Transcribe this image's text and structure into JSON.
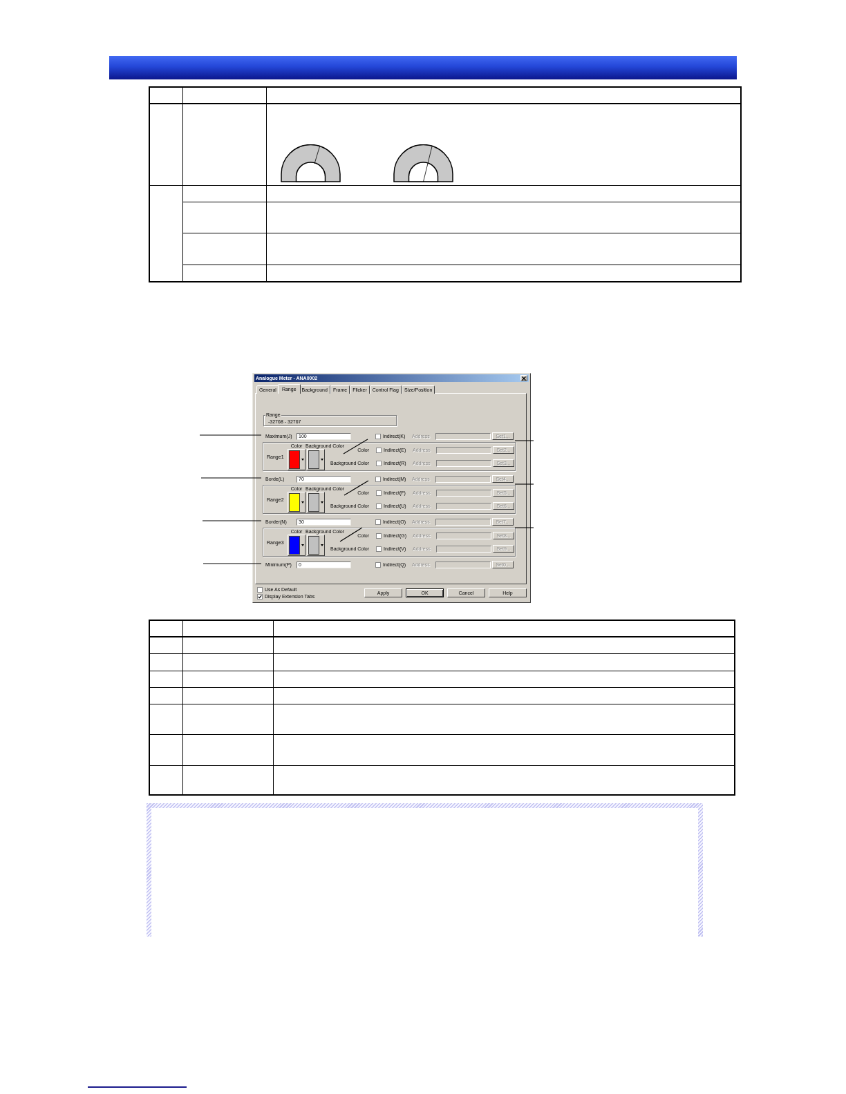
{
  "dialog": {
    "title": "Analogue Meter - ANA0002",
    "tabs": [
      {
        "label": "General",
        "selected": false
      },
      {
        "label": "Range",
        "selected": true
      },
      {
        "label": "Background",
        "selected": false
      },
      {
        "label": "Frame",
        "selected": false
      },
      {
        "label": "Flicker",
        "selected": false
      },
      {
        "label": "Control Flag",
        "selected": false
      },
      {
        "label": "Size/Position",
        "selected": false
      }
    ],
    "range_box": {
      "legend": "Range",
      "value": "-32768 - 32767"
    },
    "rows": [
      {
        "kind": "limit",
        "label": "Maximum(J)",
        "value": "100",
        "indirect": {
          "label": "Indirect(K)",
          "checked": false
        },
        "address": {
          "label": "Address",
          "disabled": true
        },
        "set_button": {
          "label": "Set1...",
          "disabled": true
        }
      },
      {
        "kind": "range",
        "label": "Range1",
        "color_header": "Color",
        "background_header": "Background Color",
        "color": "#ff0000",
        "targets": [
          {
            "label": "Color",
            "indirect": {
              "label": "Indirect(E)",
              "checked": false
            },
            "address": {
              "label": "Address",
              "disabled": true
            },
            "set_button": {
              "label": "Set2...",
              "disabled": true
            }
          },
          {
            "label": "Background Color",
            "indirect": {
              "label": "Indirect(R)",
              "checked": false
            },
            "address": {
              "label": "Address",
              "disabled": true
            },
            "set_button": {
              "label": "Set3...",
              "disabled": true
            }
          }
        ]
      },
      {
        "kind": "limit",
        "label": "Borde(L)",
        "value": "70",
        "indirect": {
          "label": "Indirect(M)",
          "checked": false
        },
        "address": {
          "label": "Address",
          "disabled": true
        },
        "set_button": {
          "label": "Set4...",
          "disabled": true
        }
      },
      {
        "kind": "range",
        "label": "Range2",
        "color_header": "Color",
        "background_header": "Background Color",
        "color": "#ffff00",
        "targets": [
          {
            "label": "Color",
            "indirect": {
              "label": "Indirect(F)",
              "checked": false
            },
            "address": {
              "label": "Address",
              "disabled": true
            },
            "set_button": {
              "label": "Set5...",
              "disabled": true
            }
          },
          {
            "label": "Background Color",
            "indirect": {
              "label": "Indirect(U)",
              "checked": false
            },
            "address": {
              "label": "Address",
              "disabled": true
            },
            "set_button": {
              "label": "Set6...",
              "disabled": true
            }
          }
        ]
      },
      {
        "kind": "limit",
        "label": "Border(N)",
        "value": "30",
        "indirect": {
          "label": "Indirect(O)",
          "checked": false
        },
        "address": {
          "label": "Address",
          "disabled": true
        },
        "set_button": {
          "label": "Set7...",
          "disabled": true
        }
      },
      {
        "kind": "range",
        "label": "Range3",
        "color_header": "Color",
        "background_header": "Background Color",
        "color": "#0000ff",
        "targets": [
          {
            "label": "Color",
            "indirect": {
              "label": "Indirect(G)",
              "checked": false
            },
            "address": {
              "label": "Address",
              "disabled": true
            },
            "set_button": {
              "label": "Set8...",
              "disabled": true
            }
          },
          {
            "label": "Background Color",
            "indirect": {
              "label": "Indirect(V)",
              "checked": false
            },
            "address": {
              "label": "Address",
              "disabled": true
            },
            "set_button": {
              "label": "Set9...",
              "disabled": true
            }
          }
        ]
      },
      {
        "kind": "limit",
        "label": "Minimum(P)",
        "value": "0",
        "indirect": {
          "label": "Indirect(Q)",
          "checked": false
        },
        "address": {
          "label": "Address",
          "disabled": true
        },
        "set_button": {
          "label": "Set0...",
          "disabled": true
        }
      }
    ],
    "options": [
      {
        "label": "Use As Default",
        "checked": false
      },
      {
        "label": "Display Extension Tabs",
        "checked": true
      }
    ],
    "buttons": [
      {
        "label": "Apply",
        "default": false
      },
      {
        "label": "OK",
        "default": true
      },
      {
        "label": "Cancel",
        "default": false
      },
      {
        "label": "Help",
        "default": false
      }
    ]
  }
}
